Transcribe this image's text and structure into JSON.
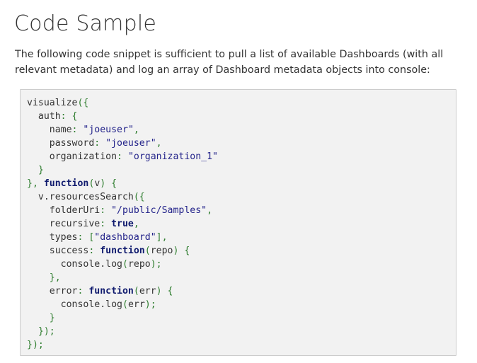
{
  "page": {
    "title": "Code Sample",
    "intro": "The following code snippet is sufficient to pull a list of available Dashboards (with all relevant metadata) and log an array of Dashboard metadata objects into console:"
  },
  "colors": {
    "string": "#23238a",
    "keyword": "#0f1a6e",
    "punctuation": "#2e7d2e",
    "text": "#333333",
    "code_background": "#f2f2f2",
    "code_border": "#cccccc"
  },
  "code": {
    "language": "javascript",
    "lines": [
      [
        {
          "t": "plain",
          "v": "visualize"
        },
        {
          "t": "punc",
          "v": "({"
        }
      ],
      [
        {
          "t": "plain",
          "v": "  auth"
        },
        {
          "t": "punc",
          "v": ": {"
        }
      ],
      [
        {
          "t": "plain",
          "v": "    name"
        },
        {
          "t": "punc",
          "v": ": "
        },
        {
          "t": "str",
          "v": "\"joeuser\""
        },
        {
          "t": "punc",
          "v": ","
        }
      ],
      [
        {
          "t": "plain",
          "v": "    password"
        },
        {
          "t": "punc",
          "v": ": "
        },
        {
          "t": "str",
          "v": "\"joeuser\""
        },
        {
          "t": "punc",
          "v": ","
        }
      ],
      [
        {
          "t": "plain",
          "v": "    organization"
        },
        {
          "t": "punc",
          "v": ": "
        },
        {
          "t": "str",
          "v": "\"organization_1\""
        }
      ],
      [
        {
          "t": "punc",
          "v": "  }"
        }
      ],
      [
        {
          "t": "punc",
          "v": "}, "
        },
        {
          "t": "kw",
          "v": "function"
        },
        {
          "t": "punc",
          "v": "("
        },
        {
          "t": "plain",
          "v": "v"
        },
        {
          "t": "punc",
          "v": ") {"
        }
      ],
      [
        {
          "t": "plain",
          "v": "  v.resourcesSearch"
        },
        {
          "t": "punc",
          "v": "({"
        }
      ],
      [
        {
          "t": "plain",
          "v": "    folderUri"
        },
        {
          "t": "punc",
          "v": ": "
        },
        {
          "t": "str",
          "v": "\"/public/Samples\""
        },
        {
          "t": "punc",
          "v": ","
        }
      ],
      [
        {
          "t": "plain",
          "v": "    recursive"
        },
        {
          "t": "punc",
          "v": ": "
        },
        {
          "t": "kw",
          "v": "true"
        },
        {
          "t": "punc",
          "v": ","
        }
      ],
      [
        {
          "t": "plain",
          "v": "    types"
        },
        {
          "t": "punc",
          "v": ": ["
        },
        {
          "t": "str",
          "v": "\"dashboard\""
        },
        {
          "t": "punc",
          "v": "],"
        }
      ],
      [
        {
          "t": "plain",
          "v": "    success"
        },
        {
          "t": "punc",
          "v": ": "
        },
        {
          "t": "kw",
          "v": "function"
        },
        {
          "t": "punc",
          "v": "("
        },
        {
          "t": "plain",
          "v": "repo"
        },
        {
          "t": "punc",
          "v": ") {"
        }
      ],
      [
        {
          "t": "plain",
          "v": "      console.log"
        },
        {
          "t": "punc",
          "v": "("
        },
        {
          "t": "plain",
          "v": "repo"
        },
        {
          "t": "punc",
          "v": ");"
        }
      ],
      [
        {
          "t": "punc",
          "v": "    },"
        }
      ],
      [
        {
          "t": "plain",
          "v": "    error"
        },
        {
          "t": "punc",
          "v": ": "
        },
        {
          "t": "kw",
          "v": "function"
        },
        {
          "t": "punc",
          "v": "("
        },
        {
          "t": "plain",
          "v": "err"
        },
        {
          "t": "punc",
          "v": ") {"
        }
      ],
      [
        {
          "t": "plain",
          "v": "      console.log"
        },
        {
          "t": "punc",
          "v": "("
        },
        {
          "t": "plain",
          "v": "err"
        },
        {
          "t": "punc",
          "v": ");"
        }
      ],
      [
        {
          "t": "punc",
          "v": "    }"
        }
      ],
      [
        {
          "t": "punc",
          "v": "  });"
        }
      ],
      [
        {
          "t": "punc",
          "v": "});"
        }
      ]
    ]
  }
}
